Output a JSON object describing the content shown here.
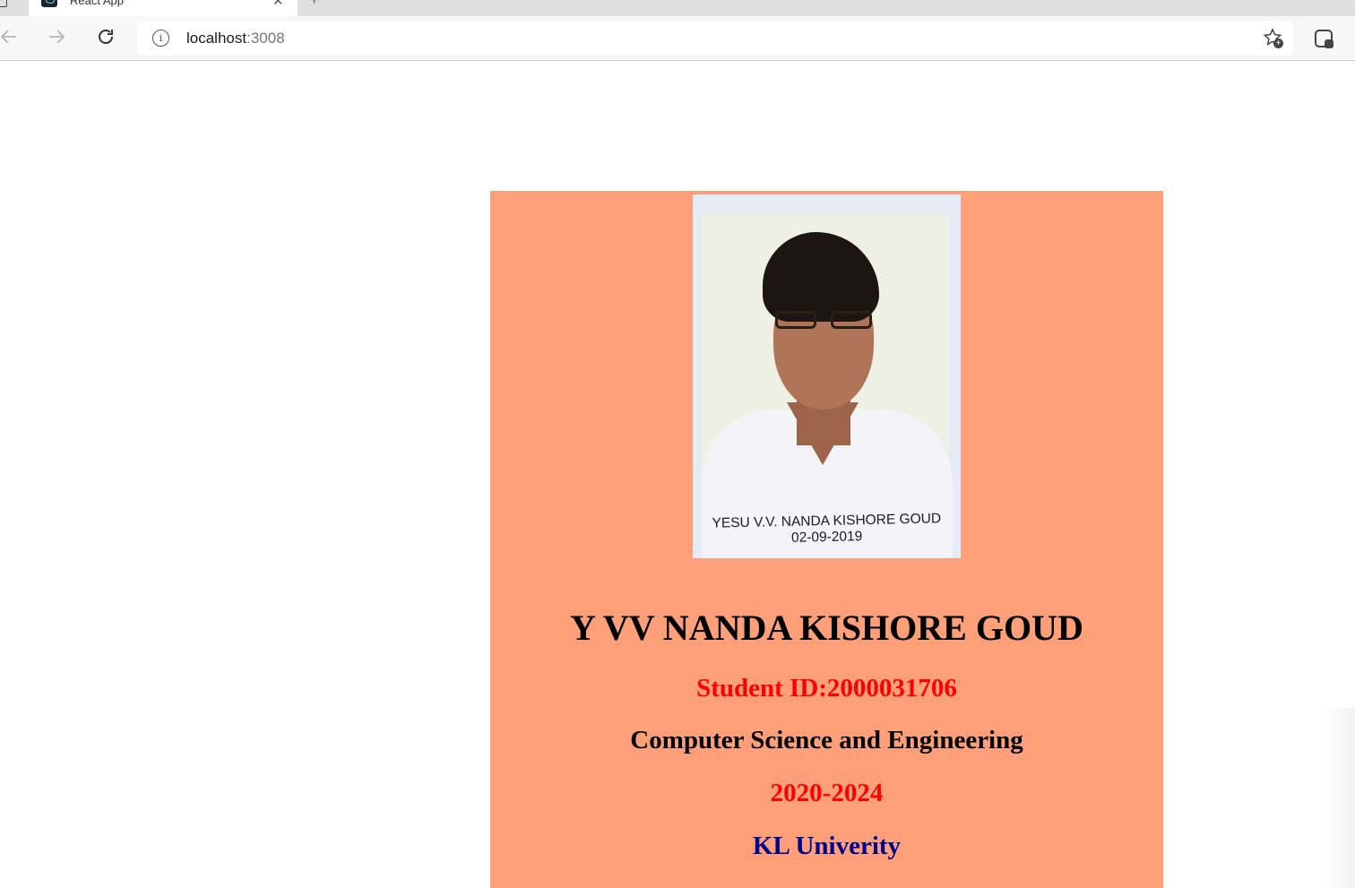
{
  "browser": {
    "tab_title": "React App",
    "tab_close": "✕",
    "new_tab": "+",
    "url_host": "localhost",
    "url_port": ":3008",
    "info_glyph": "i",
    "icons": [
      "back-arrow-icon",
      "forward-arrow-icon",
      "reload-icon",
      "info-icon",
      "favorite-add-icon",
      "extension-icon",
      "react-favicon"
    ]
  },
  "card": {
    "background": "#fda07a",
    "photo_caption_line1": "YESU V.V. NANDA KISHORE GOUD",
    "photo_caption_line2": "02-09-2019",
    "name": "Y VV NANDA KISHORE GOUD",
    "student_id": "Student ID:2000031706",
    "branch": "Computer Science and Engineering",
    "years": "2020-2024",
    "university": "KL Univerity",
    "colors": {
      "name": "#000000",
      "student_id": "#ff0000",
      "branch": "#000000",
      "years": "#ff0000",
      "university": "#00008b"
    }
  }
}
